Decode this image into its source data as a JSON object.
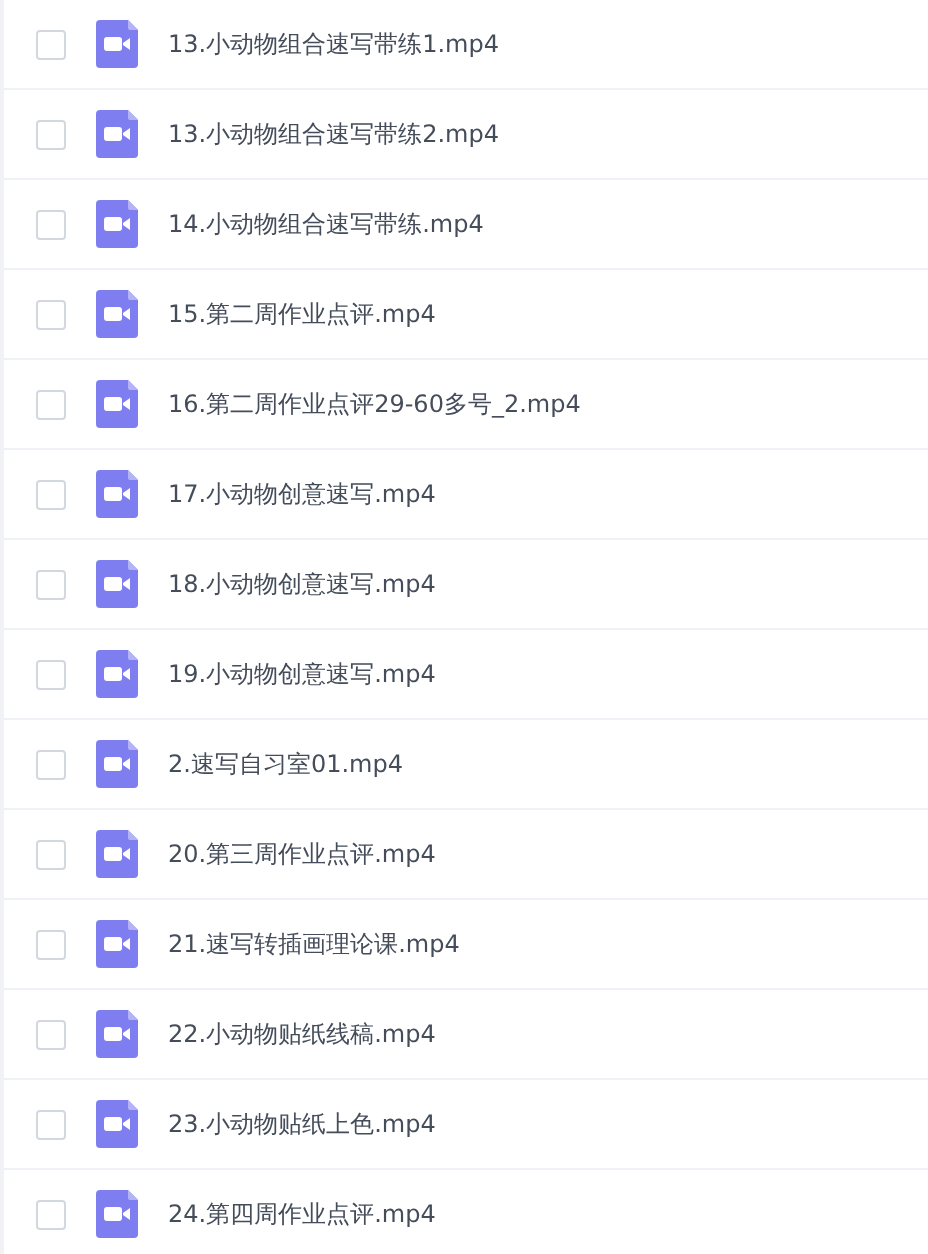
{
  "files": [
    {
      "name": "13.小动物组合速写带练1.mp4",
      "checked": false
    },
    {
      "name": "13.小动物组合速写带练2.mp4",
      "checked": false
    },
    {
      "name": "14.小动物组合速写带练.mp4",
      "checked": false
    },
    {
      "name": "15.第二周作业点评.mp4",
      "checked": false
    },
    {
      "name": "16.第二周作业点评29-60多号_2.mp4",
      "checked": false
    },
    {
      "name": "17.小动物创意速写.mp4",
      "checked": false
    },
    {
      "name": "18.小动物创意速写.mp4",
      "checked": false
    },
    {
      "name": "19.小动物创意速写.mp4",
      "checked": false
    },
    {
      "name": "2.速写自习室01.mp4",
      "checked": false
    },
    {
      "name": "20.第三周作业点评.mp4",
      "checked": false
    },
    {
      "name": "21.速写转插画理论课.mp4",
      "checked": false
    },
    {
      "name": "22.小动物贴纸线稿.mp4",
      "checked": false
    },
    {
      "name": "23.小动物贴纸上色.mp4",
      "checked": false
    },
    {
      "name": "24.第四周作业点评.mp4",
      "checked": false
    }
  ]
}
